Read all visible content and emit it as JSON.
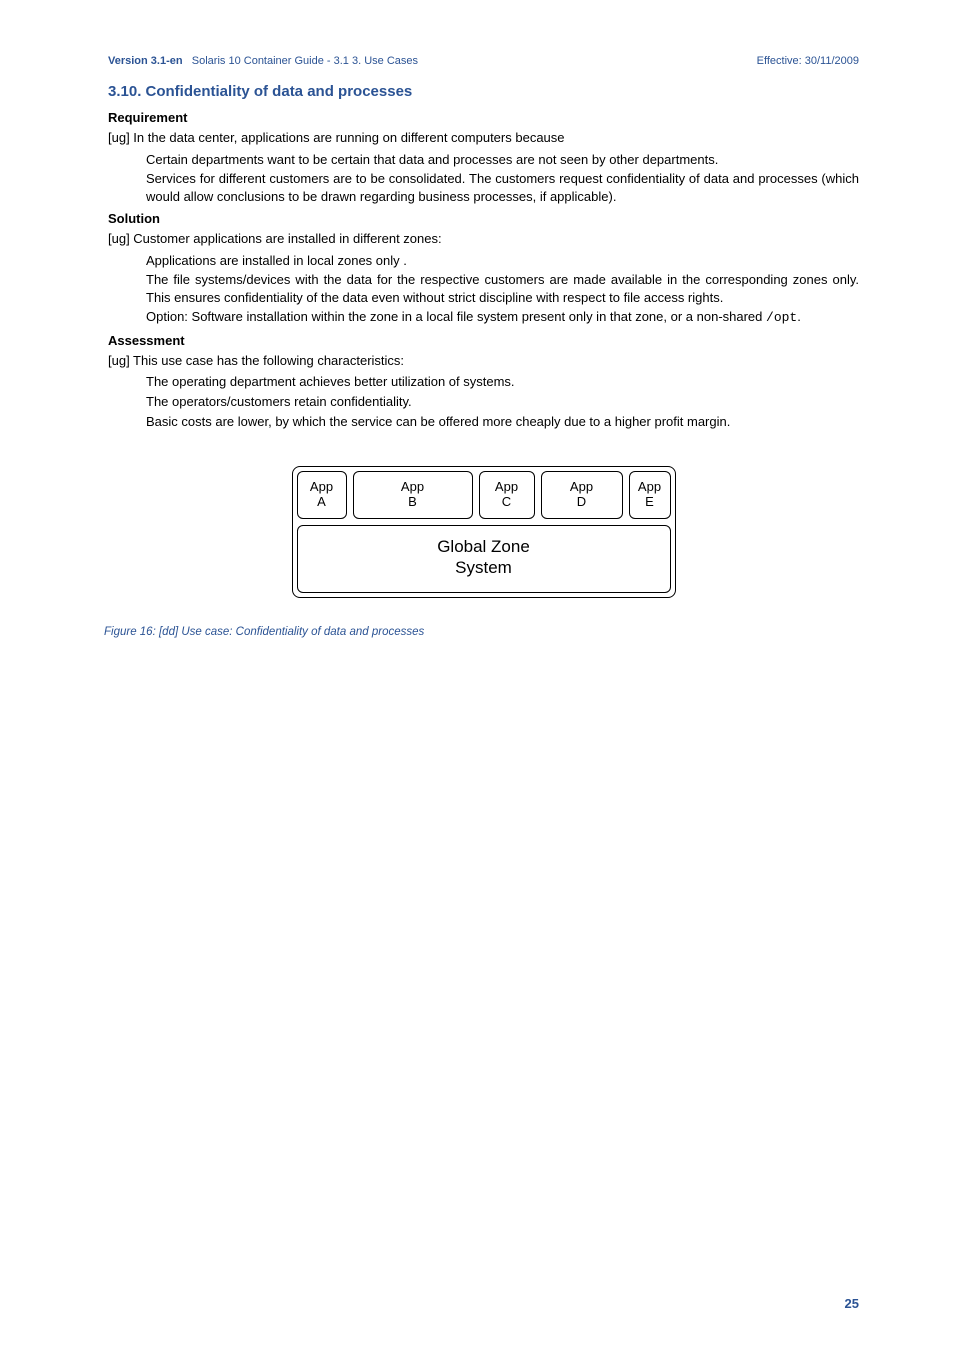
{
  "header": {
    "version": "Version 3.1-en",
    "doc_title": "Solaris 10 Container Guide - 3.1   3. Use Cases",
    "effective": "Effective: 30/11/2009"
  },
  "section": {
    "number_title": "3.10. Confidentiality of data and processes"
  },
  "requirement": {
    "heading": "Requirement",
    "intro": "[ug] In the data center, applications are running on different computers because",
    "items": [
      "Certain departments want to be certain that data and processes are not seen by other departments.",
      "Services for different customers are to be consolidated. The customers request confidentiality of data and processes (which would allow conclusions to be drawn regarding business processes, if applicable)."
    ]
  },
  "solution": {
    "heading": "Solution",
    "intro": "[ug] Customer applications are installed in different zones:",
    "items": [
      "Applications are installed in local zones only .",
      "The file systems/devices with the data for the respective customers are made available in the corresponding zones only. This ensures confidentiality of the data even without strict discipline with respect to file access rights.",
      "Option: Software installation within the zone in a local file system present only in that zone, or a non-shared "
    ],
    "opt_code": "/opt",
    "opt_tail": "."
  },
  "assessment": {
    "heading": "Assessment",
    "intro": "[ug] This use case has the following characteristics:",
    "items": [
      "The operating department achieves better utilization of systems.",
      "The operators/customers retain confidentiality.",
      "Basic costs are lower, by which the service can be offered more cheaply due to a higher profit margin."
    ]
  },
  "diagram": {
    "apps": {
      "a": {
        "l1": "App",
        "l2": "A"
      },
      "b": {
        "l1": "App",
        "l2": "B"
      },
      "c": {
        "l1": "App",
        "l2": "C"
      },
      "d": {
        "l1": "App",
        "l2": "D"
      },
      "e": {
        "l1": "App",
        "l2": "E"
      }
    },
    "global": {
      "l1": "Global Zone",
      "l2": "System"
    }
  },
  "figure_caption": "Figure 16: [dd] Use case: Confidentiality of data and processes",
  "page_number": "25"
}
